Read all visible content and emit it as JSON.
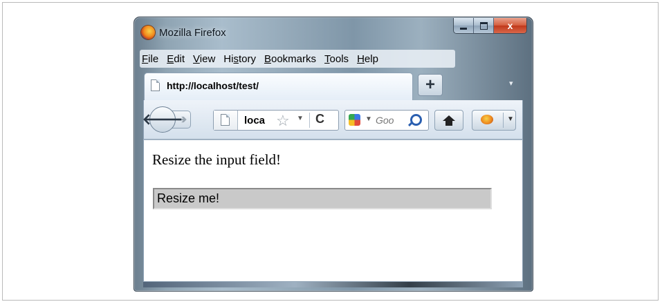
{
  "window": {
    "title": "Mozilla Firefox",
    "close_glyph": "x"
  },
  "menubar": {
    "items": [
      {
        "underline": "F",
        "rest": "ile"
      },
      {
        "underline": "E",
        "rest": "dit"
      },
      {
        "underline": "V",
        "rest": "iew"
      },
      {
        "pre": "Hi",
        "underline": "s",
        "rest": "tory"
      },
      {
        "underline": "B",
        "rest": "ookmarks"
      },
      {
        "underline": "T",
        "rest": "ools"
      },
      {
        "underline": "H",
        "rest": "elp"
      }
    ]
  },
  "tab": {
    "title": "http://localhost/test/",
    "new_tab_label": "+"
  },
  "navbar": {
    "url_text": "loca",
    "search_placeholder": "Goo",
    "icons": [
      "back-arrow-icon",
      "forward-arrow-icon",
      "page-icon",
      "star-icon",
      "reload-icon",
      "google-icon",
      "magnifier-icon",
      "home-icon",
      "firebug-icon"
    ]
  },
  "page": {
    "heading": "Resize the input field!",
    "input_value": "Resize me!"
  }
}
